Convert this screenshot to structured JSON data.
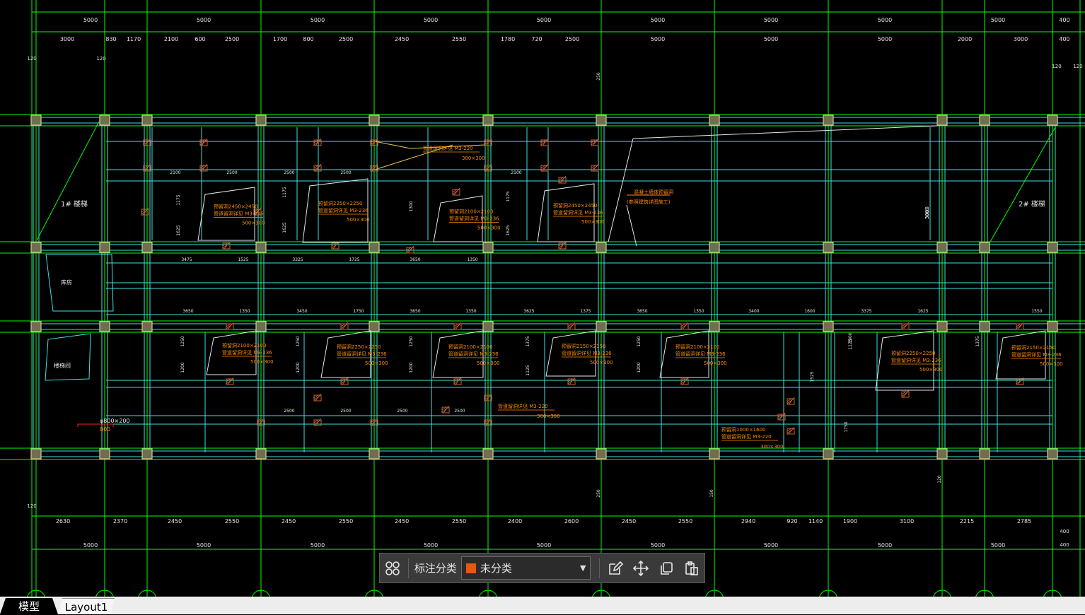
{
  "colors": {
    "background": "#000000",
    "grid": "#00ff00",
    "wall": "#40e0e0",
    "column": "#d2d284",
    "annotation": "#ff8c00",
    "hatch": "#c86432",
    "text": "#e6e6e6"
  },
  "dims": {
    "top_major": [
      "5000",
      "5000",
      "5000",
      "5000",
      "5000",
      "5000",
      "5000",
      "5000",
      "5000",
      "400"
    ],
    "top_minor": [
      "3000",
      "830",
      "1170",
      "2100",
      "600",
      "2500",
      "1700",
      "800",
      "2500",
      "2450",
      "2550",
      "1780",
      "720",
      "2500",
      "5000",
      "5000",
      "5000",
      "2000",
      "3000",
      "400"
    ],
    "bottom_minor": [
      "2630",
      "2370",
      "2450",
      "2550",
      "2450",
      "2550",
      "2450",
      "2550",
      "2400",
      "2600",
      "2450",
      "2550",
      "2940",
      "920",
      "1140",
      "1900",
      "3100",
      "2215",
      "2785"
    ],
    "bottom_major": [
      "5000",
      "5000",
      "5000",
      "5000",
      "5000",
      "5000",
      "5000",
      "5000",
      "5000"
    ],
    "side_left": [
      "120",
      "120",
      "120"
    ],
    "side_right": [
      "120",
      "120",
      "400",
      "400"
    ],
    "row_a": [
      "2100",
      "2500",
      "2500",
      "2500",
      "2100"
    ],
    "row_b": [
      "3475",
      "1525",
      "3325",
      "1725",
      "3650",
      "1350"
    ],
    "row_c": [
      "3650",
      "1350",
      "3450",
      "1750",
      "3650",
      "1350",
      "3625",
      "1375",
      "3650",
      "1350",
      "3400",
      "1600",
      "3375",
      "1625",
      "1550"
    ],
    "row_d": [
      "2500",
      "2500",
      "2500",
      "2500"
    ],
    "heights": [
      "1175",
      "1625",
      "1175",
      "1625",
      "1300",
      "1175",
      "1625",
      "1250",
      "1200",
      "1250",
      "1200",
      "1250",
      "1200",
      "1375",
      "1125",
      "1250",
      "1200",
      "1125",
      "1375",
      "1750",
      "3000",
      "250",
      "250",
      "150",
      "120",
      "1900",
      "1525"
    ]
  },
  "labels": {
    "stair1": "1# 楼梯",
    "stair2": "2# 楼梯",
    "room_a": "库房",
    "room_b": "楼梯间",
    "note_right_1": "混凝土墙体预留洞",
    "note_right_2": "(参照建筑详图施工)",
    "dim_800": "800",
    "pipe_label": "φ800×200",
    "tag_3000": "3000"
  },
  "openings": [
    {
      "line1": "预留洞2450×2450",
      "line2": "管道留洞详见 M3-236",
      "size": "500×300"
    },
    {
      "line1": "预留洞2250×2250",
      "line2": "管道留洞详见 M3-236",
      "size": "500×300"
    },
    {
      "line1": "预留洞2100×2100",
      "line2": "管道留洞详见 M3-236",
      "size": "500×300"
    },
    {
      "line1": "预留洞2450×2450",
      "line2": "管道留洞详见 M3-236",
      "size": "500×300"
    },
    {
      "line1": "预留洞2100×2100",
      "line2": "管道留洞详见 M3-236",
      "size": "500×300"
    },
    {
      "line1": "预留洞2250×2250",
      "line2": "管道留洞详见 M3-236",
      "size": "500×300"
    },
    {
      "line1": "预留洞2100×2100",
      "line2": "管道留洞详见 M3-236",
      "size": "500×300"
    },
    {
      "line1": "预留洞2150×2150",
      "line2": "管道留洞详见 M3-236",
      "size": "500×300"
    },
    {
      "line1": "预留洞2100×2100",
      "line2": "管道留洞详见 M3-236",
      "size": "500×300"
    },
    {
      "line1": "预留洞2250×2250",
      "line2": "管道留洞详见 M3-236",
      "size": "500×300"
    },
    {
      "line1": "预留洞2150×2150",
      "line2": "管道留洞详见 M3-236",
      "size": "500×300"
    }
  ],
  "beam_notes": [
    {
      "line1": "管道留洞详见 M3-220",
      "size": "300×300"
    },
    {
      "line1": "管道留洞详见 M3-220",
      "size": "300×300"
    },
    {
      "line1": "预留洞1000×1600",
      "line2": "管道留洞详见 M3-220",
      "size": "300×300"
    }
  ],
  "toolbar": {
    "grid_icon": "grid-icon",
    "category_label": "标注分类",
    "category_value": "未分类",
    "category_color": "#e05a10",
    "edit_icon": "edit-icon",
    "move_icon": "move-icon",
    "copy_icon": "copy-icon",
    "paste_icon": "paste-icon"
  },
  "tabs": {
    "model": "模型",
    "layout": "Layout1"
  }
}
